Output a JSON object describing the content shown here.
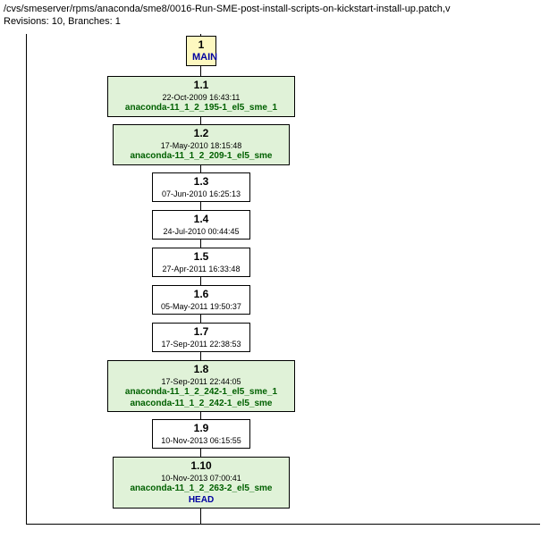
{
  "header": {
    "path": "/cvs/smeserver/rpms/anaconda/sme8/0016-Run-SME-post-install-scripts-on-kickstart-install-up.patch,v",
    "summary": "Revisions: 10, Branches: 1"
  },
  "nodes": {
    "branch": {
      "num": "1",
      "label": "MAIN"
    },
    "n11": {
      "rev": "1.1",
      "date": "22-Oct-2009 16:43:11",
      "tag": "anaconda-11_1_2_195-1_el5_sme_1"
    },
    "n12": {
      "rev": "1.2",
      "date": "17-May-2010 18:15:48",
      "tag": "anaconda-11_1_2_209-1_el5_sme"
    },
    "n13": {
      "rev": "1.3",
      "date": "07-Jun-2010 16:25:13"
    },
    "n14": {
      "rev": "1.4",
      "date": "24-Jul-2010 00:44:45"
    },
    "n15": {
      "rev": "1.5",
      "date": "27-Apr-2011 16:33:48"
    },
    "n16": {
      "rev": "1.6",
      "date": "05-May-2011 19:50:37"
    },
    "n17": {
      "rev": "1.7",
      "date": "17-Sep-2011 22:38:53"
    },
    "n18": {
      "rev": "1.8",
      "date": "17-Sep-2011 22:44:05",
      "tag1": "anaconda-11_1_2_242-1_el5_sme_1",
      "tag2": "anaconda-11_1_2_242-1_el5_sme"
    },
    "n19": {
      "rev": "1.9",
      "date": "10-Nov-2013 06:15:55"
    },
    "n110": {
      "rev": "1.10",
      "date": "10-Nov-2013 07:00:41",
      "tag": "anaconda-11_1_2_263-2_el5_sme",
      "head": "HEAD"
    }
  }
}
